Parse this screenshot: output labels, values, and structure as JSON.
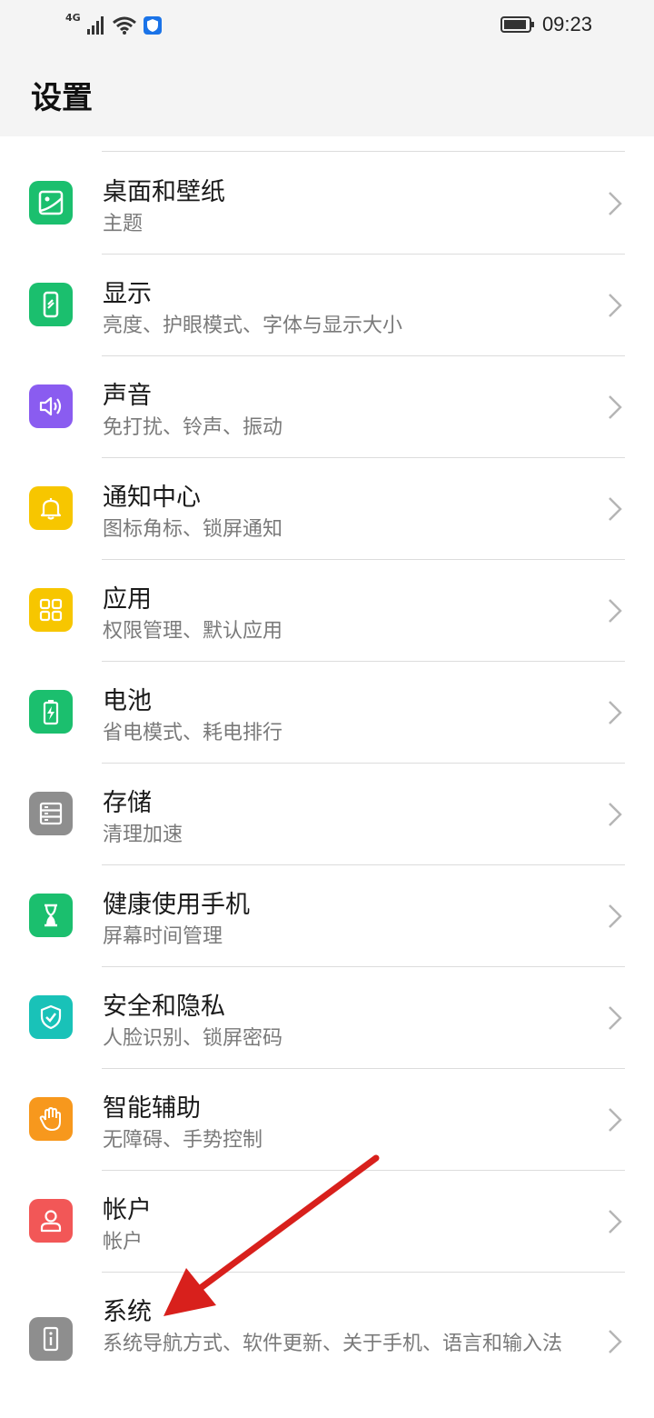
{
  "status": {
    "network": "4G",
    "time": "09:23"
  },
  "header": {
    "title": "设置"
  },
  "items": [
    {
      "title": "桌面和壁纸",
      "subtitle": "主题",
      "icon": "wallpaper-icon",
      "color": "#1bbf6e"
    },
    {
      "title": "显示",
      "subtitle": "亮度、护眼模式、字体与显示大小",
      "icon": "display-icon",
      "color": "#1bbf6e"
    },
    {
      "title": "声音",
      "subtitle": "免打扰、铃声、振动",
      "icon": "sound-icon",
      "color": "#8a5cf0"
    },
    {
      "title": "通知中心",
      "subtitle": "图标角标、锁屏通知",
      "icon": "bell-icon",
      "color": "#f7c600"
    },
    {
      "title": "应用",
      "subtitle": "权限管理、默认应用",
      "icon": "apps-icon",
      "color": "#f7c600"
    },
    {
      "title": "电池",
      "subtitle": "省电模式、耗电排行",
      "icon": "battery-icon",
      "color": "#1bbf6e"
    },
    {
      "title": "存储",
      "subtitle": "清理加速",
      "icon": "storage-icon",
      "color": "#8e8e8e"
    },
    {
      "title": "健康使用手机",
      "subtitle": "屏幕时间管理",
      "icon": "hourglass-icon",
      "color": "#1bbf6e"
    },
    {
      "title": "安全和隐私",
      "subtitle": "人脸识别、锁屏密码",
      "icon": "shield-icon",
      "color": "#19c2b8"
    },
    {
      "title": "智能辅助",
      "subtitle": "无障碍、手势控制",
      "icon": "hand-icon",
      "color": "#f7981d"
    },
    {
      "title": "帐户",
      "subtitle": "帐户",
      "icon": "user-icon",
      "color": "#f25757"
    },
    {
      "title": "系统",
      "subtitle": "系统导航方式、软件更新、关于手机、语言和输入法",
      "icon": "info-icon",
      "color": "#8e8e8e"
    }
  ],
  "annotation": {
    "arrow_color": "#d8201c"
  }
}
